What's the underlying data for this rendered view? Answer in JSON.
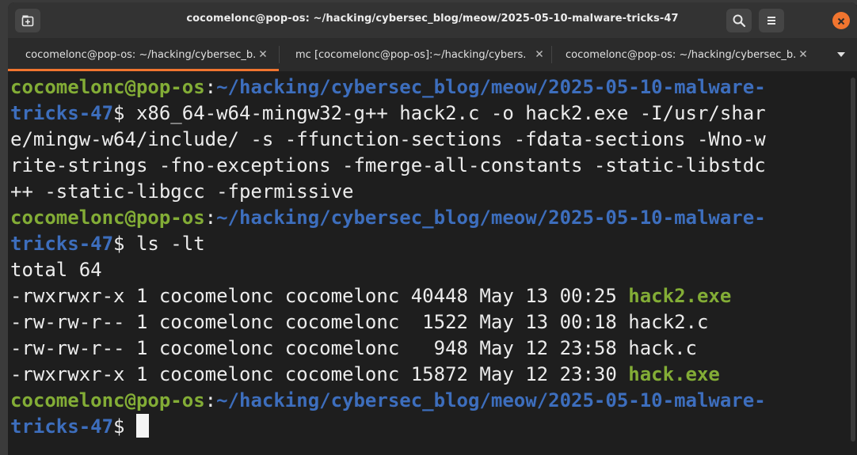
{
  "window": {
    "title": "cocomelonc@pop-os: ~/hacking/cybersec_blog/meow/2025-05-10-malware-tricks-47"
  },
  "tabs": [
    {
      "label": "cocomelonc@pop-os: ~/hacking/cybersec_b...",
      "active": true
    },
    {
      "label": "mc [cocomelonc@pop-os]:~/hacking/cybers...",
      "active": false
    },
    {
      "label": "cocomelonc@pop-os: ~/hacking/cybersec_b...",
      "active": false
    }
  ],
  "icons": {
    "new_tab": "new-tab-icon",
    "search": "search-icon",
    "menu": "hamburger-menu-icon",
    "close": "close-icon",
    "tab_close": "close-icon",
    "dropdown": "chevron-down-icon"
  },
  "colors": {
    "accent": "#f1752f",
    "prompt_user": "#83ad36",
    "prompt_path": "#3d6ebd",
    "executable": "#83ad36",
    "text": "#ececec",
    "background": "#1e1e1e"
  },
  "terminal": {
    "prompt_user": "cocomelonc@pop-os",
    "prompt_colon": ":",
    "prompt_path_a": "~/hacking/cybersec_blog/meow/2025-05-10-malware-",
    "prompt_path_b": "tricks-47",
    "prompt_symbol": "$ ",
    "cmd1_line1": "x86_64-w64-mingw32-g++ hack2.c -o hack2.exe -I/usr/shar",
    "cmd1_line2": "e/mingw-w64/include/ -s -ffunction-sections -fdata-sections -Wno-w",
    "cmd1_line3": "rite-strings -fno-exceptions -fmerge-all-constants -static-libstdc",
    "cmd1_line4": "++ -static-libgcc -fpermissive",
    "cmd2": "ls -lt",
    "total": "total 64",
    "files": [
      {
        "prefix": "-rwxrwxr-x 1 cocomelonc cocomelonc 40448 May 13 00:25 ",
        "name": "hack2.exe"
      },
      {
        "prefix": "-rw-rw-r-- 1 cocomelonc cocomelonc  1522 May 13 00:18 ",
        "name": "hack2.c"
      },
      {
        "prefix": "-rw-rw-r-- 1 cocomelonc cocomelonc   948 May 12 23:58 ",
        "name": "hack.c"
      },
      {
        "prefix": "-rwxrwxr-x 1 cocomelonc cocomelonc 15872 May 12 23:30 ",
        "name": "hack.exe"
      }
    ]
  }
}
